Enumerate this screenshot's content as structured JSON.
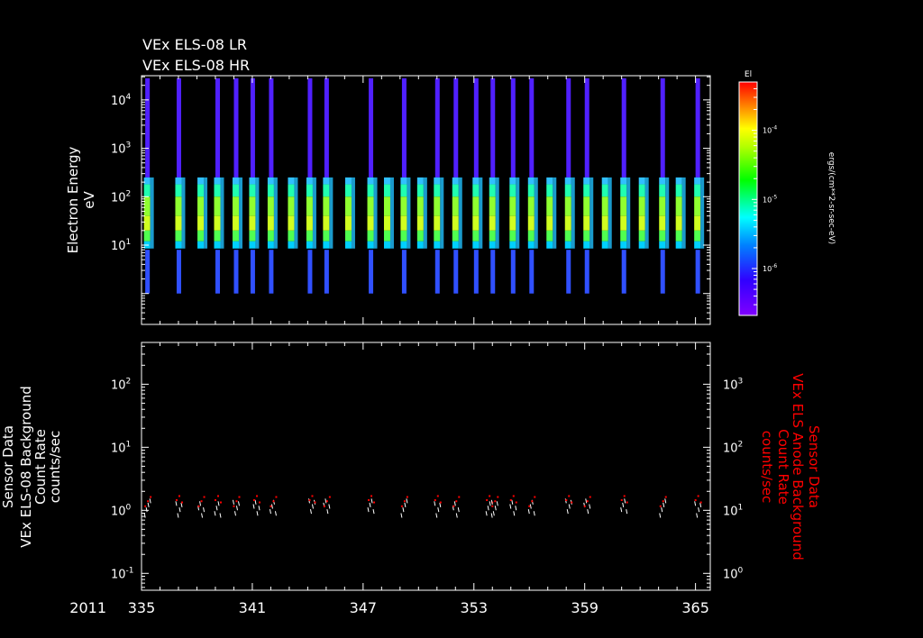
{
  "chart_data": [
    {
      "type": "heatmap",
      "titles": [
        "VEx ELS-08 LR",
        "VEx ELS-08 HR"
      ],
      "ylabel": [
        "Electron Energy",
        "eV"
      ],
      "yscale": "log",
      "ylim": [
        0.23,
        31623
      ],
      "yticks": [
        {
          "v": 10,
          "e": "1"
        },
        {
          "v": 100,
          "e": "2"
        },
        {
          "v": 1000,
          "e": "3"
        },
        {
          "v": 10000,
          "e": "4"
        }
      ],
      "xlim": [
        335,
        365.8
      ],
      "colorbar": {
        "title": "El",
        "units": "ergs/(cm**2-sr-sec-eV)",
        "range": [
          2.1e-07,
          0.0005
        ],
        "ticks": [
          {
            "v": 0.0001,
            "e": "-4"
          },
          {
            "v": 1e-05,
            "e": "-5"
          },
          {
            "v": 1e-06,
            "e": "-6"
          }
        ]
      },
      "passes": [
        {
          "day": 335.3,
          "full": true
        },
        {
          "day": 337.0,
          "full": true
        },
        {
          "day": 338.2,
          "full": false
        },
        {
          "day": 339.1,
          "full": true
        },
        {
          "day": 340.1,
          "full": true
        },
        {
          "day": 341.0,
          "full": true
        },
        {
          "day": 342.0,
          "full": true
        },
        {
          "day": 343.1,
          "full": false
        },
        {
          "day": 344.1,
          "full": true
        },
        {
          "day": 345.0,
          "full": true
        },
        {
          "day": 346.2,
          "full": false
        },
        {
          "day": 347.4,
          "full": true
        },
        {
          "day": 348.3,
          "full": false
        },
        {
          "day": 349.2,
          "full": true
        },
        {
          "day": 350.1,
          "full": false
        },
        {
          "day": 351.0,
          "full": true
        },
        {
          "day": 352.0,
          "full": true
        },
        {
          "day": 353.1,
          "full": true
        },
        {
          "day": 354.0,
          "full": true
        },
        {
          "day": 355.1,
          "full": true
        },
        {
          "day": 356.1,
          "full": true
        },
        {
          "day": 357.1,
          "full": false
        },
        {
          "day": 358.1,
          "full": true
        },
        {
          "day": 359.1,
          "full": true
        },
        {
          "day": 360.1,
          "full": false
        },
        {
          "day": 361.1,
          "full": true
        },
        {
          "day": 362.1,
          "full": false
        },
        {
          "day": 363.2,
          "full": true
        },
        {
          "day": 364.1,
          "full": false
        },
        {
          "day": 365.1,
          "full": true
        }
      ]
    },
    {
      "type": "scatter",
      "ylabel_left": [
        "Sensor Data",
        "VEx ELS-08 Background",
        "Count Rate",
        "counts/sec"
      ],
      "ylabel_right": [
        "Sensor Data",
        "VEx ELS Anode Background",
        "Count Rate",
        "counts/sec"
      ],
      "yscale": "log",
      "ylim_left": [
        0.054,
        460
      ],
      "ylim_right": [
        0.54,
        4600
      ],
      "yticks_left": [
        {
          "v": 0.1,
          "e": "-1"
        },
        {
          "v": 1,
          "e": "0"
        },
        {
          "v": 10,
          "e": "1"
        },
        {
          "v": 100,
          "e": "2"
        }
      ],
      "yticks_right": [
        {
          "v": 1,
          "e": "0"
        },
        {
          "v": 10,
          "e": "1"
        },
        {
          "v": 100,
          "e": "2"
        },
        {
          "v": 1000,
          "e": "3"
        }
      ],
      "xlabel_year": "2011",
      "xticks": [
        335,
        341,
        347,
        353,
        359,
        365
      ],
      "xlim": [
        335,
        365.8
      ],
      "series": [
        {
          "name": "ELS-08 Background",
          "color": "#ffffff",
          "values_typical": [
            0.9,
            1.6
          ]
        },
        {
          "name": "ELS Anode Background",
          "color": "#ff0000",
          "values_typical": [
            12,
            18
          ]
        }
      ],
      "clusters": [
        335.3,
        337.0,
        338.2,
        339.1,
        340.1,
        341.2,
        342.1,
        344.2,
        345.0,
        347.4,
        349.2,
        351.0,
        352.0,
        353.8,
        354.1,
        355.1,
        356.1,
        358.1,
        359.1,
        361.1,
        363.2,
        365.1
      ]
    }
  ]
}
